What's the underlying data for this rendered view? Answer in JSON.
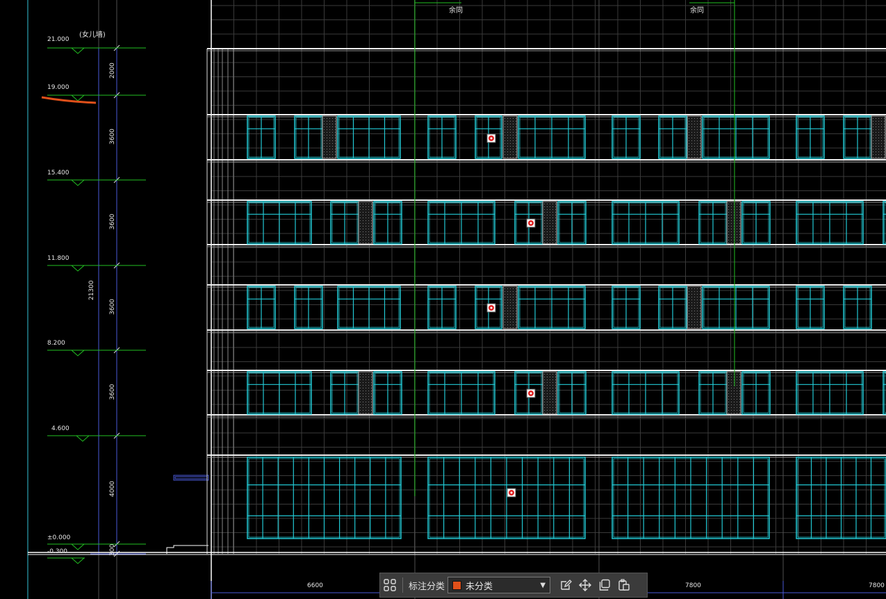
{
  "elevations": [
    {
      "value": "21.000",
      "note": "(女儿墙)"
    },
    {
      "value": "19.000"
    },
    {
      "value": "15.400"
    },
    {
      "value": "11.800"
    },
    {
      "value": "8.200"
    },
    {
      "value": "4.600"
    },
    {
      "value": "±0.000"
    },
    {
      "value": "-0.300"
    }
  ],
  "vertical_dims": [
    "2000",
    "3600",
    "3600",
    "3600",
    "3600",
    "4000",
    "300"
  ],
  "total_dim": "21300",
  "top_notes": [
    "余同",
    "余同"
  ],
  "bottom_dims": [
    "6600",
    "7800",
    "7800"
  ],
  "toolbar": {
    "label": "标注分类",
    "selected": "未分类",
    "swatch_color": "#e0501a",
    "icons": [
      "grid-icon",
      "edit-icon",
      "move-icon",
      "copy-icon",
      "paste-icon"
    ]
  },
  "colors": {
    "grid": "#4d4d4d",
    "window": "#22c9d4",
    "level_line": "#22c022",
    "dimension": "#4a5ad8",
    "marker": "#e0501a"
  }
}
